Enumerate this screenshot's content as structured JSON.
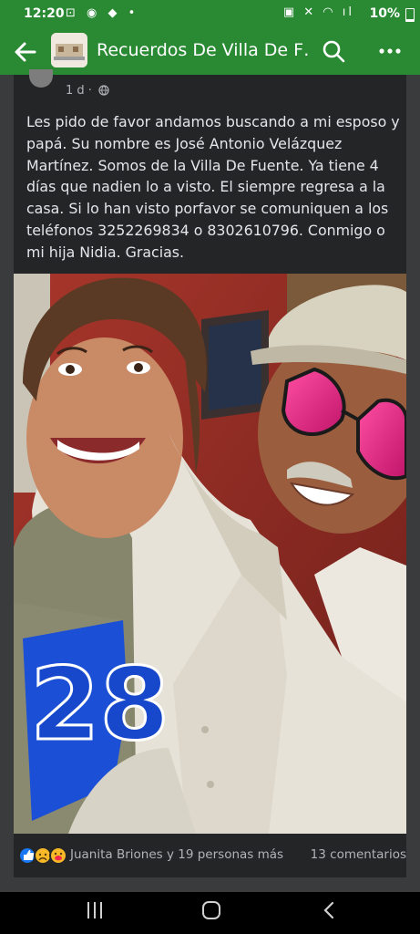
{
  "status_bar": {
    "time": "12:20",
    "battery": "10%"
  },
  "header": {
    "title": "Recuerdos De Villa De F…"
  },
  "post": {
    "time": "1 d ·",
    "text": "Les pido de favor andamos buscando a mi esposo y papá. Su nombre es José Antonio Velázquez Martínez. Somos de la Villa De Fuente. Ya tiene 4 días que nadien lo a visto. El siempre regresa a la casa. Si lo han visto porfavor se comuniquen a los teléfonos 3252269834 o 8302610796. Conmigo o mi hija Nidia. Gracias.",
    "photo_jersey_number": "28",
    "reactions": {
      "summary": "Juanita Briones y 19 personas más",
      "icons": [
        "like-icon",
        "sad-icon",
        "care-icon"
      ]
    },
    "comments": "13 comentarios"
  },
  "colors": {
    "header_bg": "#2a8a34",
    "card_bg": "#242526",
    "text": "#e4e6eb",
    "muted": "#b0b3b8"
  }
}
